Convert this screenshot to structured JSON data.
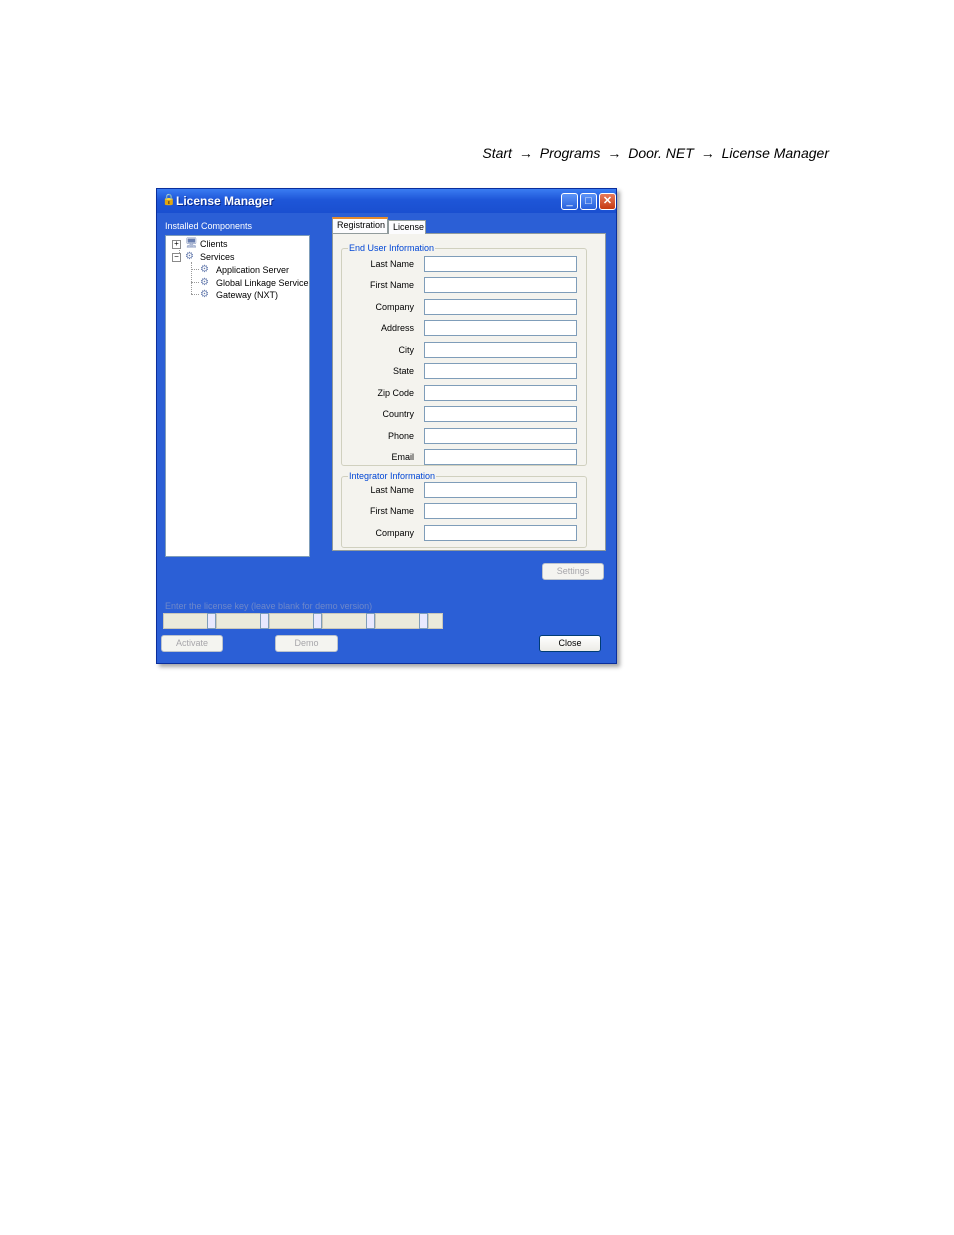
{
  "breadcrumb": {
    "items": [
      "Start",
      "Programs",
      "Door. NET",
      "License Manager"
    ],
    "separator": "→"
  },
  "window": {
    "title": "License Manager",
    "minimize": "_",
    "maximize": "□",
    "close": "✕"
  },
  "components": {
    "label": "Installed Components",
    "tree": {
      "clients": "Clients",
      "services": "Services",
      "children": [
        "Application Server",
        "Global Linkage Service",
        "Gateway (NXT)"
      ]
    }
  },
  "tabs": {
    "registration": "Registration",
    "license": "License"
  },
  "end_user": {
    "title": "End User Information",
    "fields": {
      "last_name": "Last Name",
      "first_name": "First Name",
      "company": "Company",
      "address": "Address",
      "city": "City",
      "state": "State",
      "zip": "Zip Code",
      "country": "Country",
      "phone": "Phone",
      "email": "Email"
    }
  },
  "integrator": {
    "title": "Integrator Information",
    "fields": {
      "last_name": "Last Name",
      "first_name": "First Name",
      "company": "Company"
    }
  },
  "buttons": {
    "settings": "Settings",
    "activate": "Activate",
    "demo": "Demo",
    "close": "Close"
  },
  "license_key": {
    "label": "Enter the license key (leave blank for demo version)"
  },
  "icons": {
    "app": "lock-icon",
    "clients": "clients-icon",
    "services": "gear-icon"
  }
}
